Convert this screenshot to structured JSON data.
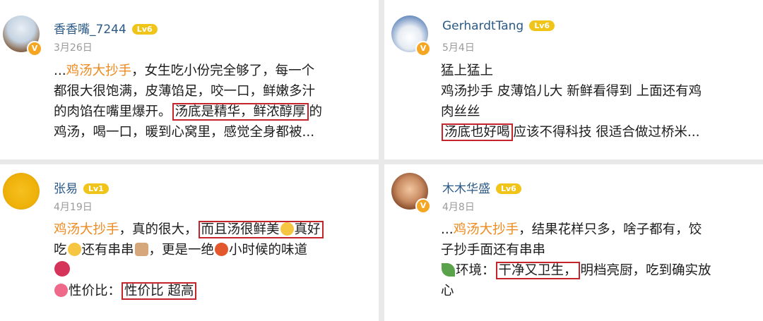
{
  "reviews": [
    {
      "username": "香香嘴_7244",
      "level": "Lv6",
      "date": "3月26日",
      "lines": [
        {
          "a": "...",
          "tag": "鸡汤大抄手",
          "b": "，女生吃小份完全够了，每一个"
        },
        {
          "a": "都很大很饱满，皮薄馅足，咬一口，鲜嫩多汁"
        },
        {
          "a": "的肉馅在嘴里爆开。",
          "box": "汤底是精华，鲜浓醇厚",
          "b": "的"
        },
        {
          "a": "鸡汤，喝一口，暖到心窝里，感觉全身都被..."
        }
      ]
    },
    {
      "username": "GerhardtTang",
      "level": "Lv6",
      "date": "5月4日",
      "lines": [
        {
          "a": "猛上猛上"
        },
        {
          "a": "鸡汤抄手 皮薄馅儿大 新鲜看得到 上面还有鸡"
        },
        {
          "a": "肉丝丝"
        },
        {
          "box": "汤底也好喝",
          "b": "应该不得科技 很适合做过桥米..."
        }
      ]
    },
    {
      "username": "张易",
      "level": "Lv1",
      "date": "4月19日",
      "lines": [
        {
          "tag": "鸡汤大抄手",
          "b": "，真的很大，",
          "box": "而且汤很鲜美",
          "e1": "😋",
          "c": "真好"
        },
        {
          "a": "吃",
          "e2": "😋",
          "b": "还有串串",
          "e3": "🍢",
          "c": "，更是一绝",
          "e4": "🍲",
          "d": "小时候的味道"
        },
        {
          "e5": "😛"
        },
        {
          "e6": "🍭",
          "a": "性价比：",
          "box": "性价比 超高"
        }
      ]
    },
    {
      "username": "木木华盛",
      "level": "Lv6",
      "date": "4月8日",
      "lines": [
        {
          "a": "...",
          "tag": "鸡汤大抄手",
          "b": "，结果花样只多，啥子都有，饺"
        },
        {
          "a": "子抄手面还有串串"
        },
        {
          "e1": "🌿",
          "a": "环境：",
          "box": "干净又卫生，",
          "b": "明档亮厨，吃到确实放"
        },
        {
          "a": "心"
        }
      ]
    }
  ]
}
